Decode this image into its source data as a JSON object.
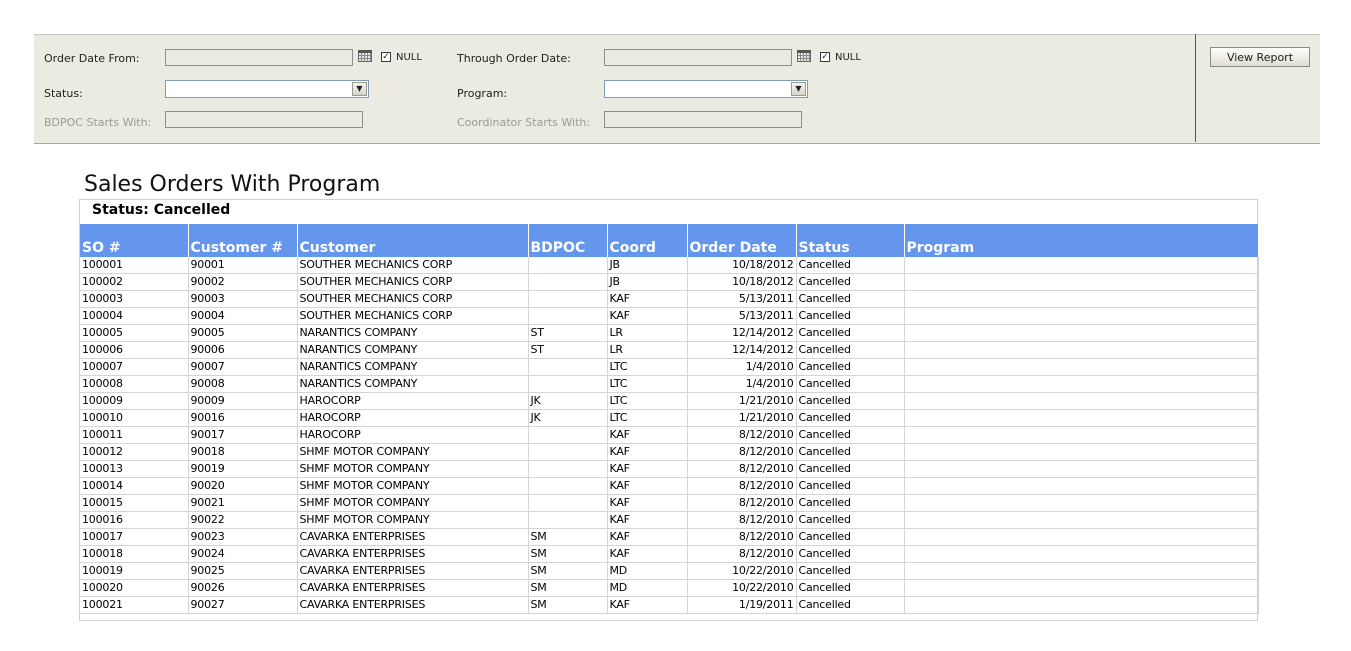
{
  "params": {
    "order_date_from_label": "Order Date From:",
    "order_date_from_value": "",
    "order_date_from_null_label": "NULL",
    "order_date_from_null_checked": true,
    "through_order_date_label": "Through Order Date:",
    "through_order_date_value": "",
    "through_order_date_null_label": "NULL",
    "through_order_date_null_checked": true,
    "status_label": "Status:",
    "status_value": "",
    "program_label": "Program:",
    "program_value": "",
    "bdpoc_label": "BDPOC Starts With:",
    "bdpoc_value": "",
    "coordinator_label": "Coordinator Starts With:",
    "coordinator_value": "",
    "view_report_label": "View Report"
  },
  "report": {
    "title": "Sales Orders With Program",
    "status_line": "Status: Cancelled",
    "columns": [
      "SO #",
      "Customer #",
      "Customer",
      "BDPOC",
      "Coord",
      "Order Date",
      "Status",
      "Program"
    ],
    "rows": [
      [
        "100001",
        "90001",
        "SOUTHER MECHANICS CORP",
        "",
        "JB",
        "10/18/2012",
        "Cancelled",
        ""
      ],
      [
        "100002",
        "90002",
        "SOUTHER MECHANICS CORP",
        "",
        "JB",
        "10/18/2012",
        "Cancelled",
        ""
      ],
      [
        "100003",
        "90003",
        "SOUTHER MECHANICS CORP",
        "",
        "KAF",
        "5/13/2011",
        "Cancelled",
        ""
      ],
      [
        "100004",
        "90004",
        "SOUTHER MECHANICS CORP",
        "",
        "KAF",
        "5/13/2011",
        "Cancelled",
        ""
      ],
      [
        "100005",
        "90005",
        "NARANTICS COMPANY",
        "ST",
        "LR",
        "12/14/2012",
        "Cancelled",
        ""
      ],
      [
        "100006",
        "90006",
        "NARANTICS COMPANY",
        "ST",
        "LR",
        "12/14/2012",
        "Cancelled",
        ""
      ],
      [
        "100007",
        "90007",
        "NARANTICS COMPANY",
        "",
        "LTC",
        "1/4/2010",
        "Cancelled",
        ""
      ],
      [
        "100008",
        "90008",
        "NARANTICS COMPANY",
        "",
        "LTC",
        "1/4/2010",
        "Cancelled",
        ""
      ],
      [
        "100009",
        "90009",
        "HAROCORP",
        "JK",
        "LTC",
        "1/21/2010",
        "Cancelled",
        ""
      ],
      [
        "100010",
        "90016",
        "HAROCORP",
        "JK",
        "LTC",
        "1/21/2010",
        "Cancelled",
        ""
      ],
      [
        "100011",
        "90017",
        "HAROCORP",
        "",
        "KAF",
        "8/12/2010",
        "Cancelled",
        ""
      ],
      [
        "100012",
        "90018",
        "SHMF MOTOR COMPANY",
        "",
        "KAF",
        "8/12/2010",
        "Cancelled",
        ""
      ],
      [
        "100013",
        "90019",
        "SHMF MOTOR COMPANY",
        "",
        "KAF",
        "8/12/2010",
        "Cancelled",
        ""
      ],
      [
        "100014",
        "90020",
        "SHMF MOTOR COMPANY",
        "",
        "KAF",
        "8/12/2010",
        "Cancelled",
        ""
      ],
      [
        "100015",
        "90021",
        "SHMF MOTOR COMPANY",
        "",
        "KAF",
        "8/12/2010",
        "Cancelled",
        ""
      ],
      [
        "100016",
        "90022",
        "SHMF MOTOR COMPANY",
        "",
        "KAF",
        "8/12/2010",
        "Cancelled",
        ""
      ],
      [
        "100017",
        "90023",
        "CAVARKA ENTERPRISES",
        "SM",
        "KAF",
        "8/12/2010",
        "Cancelled",
        ""
      ],
      [
        "100018",
        "90024",
        "CAVARKA ENTERPRISES",
        "SM",
        "KAF",
        "8/12/2010",
        "Cancelled",
        ""
      ],
      [
        "100019",
        "90025",
        "CAVARKA ENTERPRISES",
        "SM",
        "MD",
        "10/22/2010",
        "Cancelled",
        ""
      ],
      [
        "100020",
        "90026",
        "CAVARKA ENTERPRISES",
        "SM",
        "MD",
        "10/22/2010",
        "Cancelled",
        ""
      ],
      [
        "100021",
        "90027",
        "CAVARKA ENTERPRISES",
        "SM",
        "KAF",
        "1/19/2011",
        "Cancelled",
        ""
      ]
    ]
  },
  "icons": {
    "calendar": "calendar-icon",
    "dropdown": "chevron-down-icon",
    "checkbox_mark": "✓"
  },
  "colors": {
    "header_bg": "#6496ed",
    "param_bg": "#ecebe2"
  }
}
